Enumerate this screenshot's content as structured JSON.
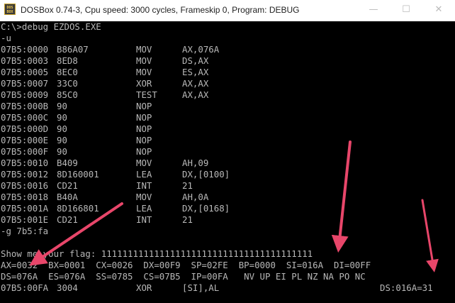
{
  "window": {
    "title": "DOSBox 0.74-3, Cpu speed:    3000 cycles, Frameskip  0, Program:   DEBUG",
    "icon_label": "DOS BOX",
    "buttons": {
      "minimize": "—",
      "maximize": "☐",
      "close": "✕"
    }
  },
  "terminal": {
    "prompt_line": "C:\\>debug EZDOS.EXE",
    "cmd_u": "-u",
    "disassembly": [
      {
        "addr": "07B5:0000",
        "bytes": "B86A07",
        "mnem": "MOV",
        "ops": "AX,076A"
      },
      {
        "addr": "07B5:0003",
        "bytes": "8ED8",
        "mnem": "MOV",
        "ops": "DS,AX"
      },
      {
        "addr": "07B5:0005",
        "bytes": "8EC0",
        "mnem": "MOV",
        "ops": "ES,AX"
      },
      {
        "addr": "07B5:0007",
        "bytes": "33C0",
        "mnem": "XOR",
        "ops": "AX,AX"
      },
      {
        "addr": "07B5:0009",
        "bytes": "85C0",
        "mnem": "TEST",
        "ops": "AX,AX"
      },
      {
        "addr": "07B5:000B",
        "bytes": "90",
        "mnem": "NOP",
        "ops": ""
      },
      {
        "addr": "07B5:000C",
        "bytes": "90",
        "mnem": "NOP",
        "ops": ""
      },
      {
        "addr": "07B5:000D",
        "bytes": "90",
        "mnem": "NOP",
        "ops": ""
      },
      {
        "addr": "07B5:000E",
        "bytes": "90",
        "mnem": "NOP",
        "ops": ""
      },
      {
        "addr": "07B5:000F",
        "bytes": "90",
        "mnem": "NOP",
        "ops": ""
      },
      {
        "addr": "07B5:0010",
        "bytes": "B409",
        "mnem": "MOV",
        "ops": "AH,09"
      },
      {
        "addr": "07B5:0012",
        "bytes": "8D160001",
        "mnem": "LEA",
        "ops": "DX,[0100]"
      },
      {
        "addr": "07B5:0016",
        "bytes": "CD21",
        "mnem": "INT",
        "ops": "21"
      },
      {
        "addr": "07B5:0018",
        "bytes": "B40A",
        "mnem": "MOV",
        "ops": "AH,0A"
      },
      {
        "addr": "07B5:001A",
        "bytes": "8D166801",
        "mnem": "LEA",
        "ops": "DX,[0168]"
      },
      {
        "addr": "07B5:001E",
        "bytes": "CD21",
        "mnem": "INT",
        "ops": "21"
      }
    ],
    "cmd_g": "-g 7b5:fa",
    "output_line": "Show me your flag: 1111111111111111111111111111111111111111",
    "registers_1": "AX=0032  BX=0001  CX=0026  DX=00F9  SP=02FE  BP=0000  SI=016A  DI=00FF",
    "registers_2": "DS=076A  ES=076A  SS=0785  CS=07B5  IP=00FA   NV UP EI PL NZ NA PO NC",
    "current_instr": {
      "addr": "07B5:00FA",
      "bytes": "3004",
      "mnem": "XOR",
      "ops": "[SI],AL",
      "mem": "DS:016A=31"
    }
  },
  "colors": {
    "terminal_bg": "#000000",
    "terminal_fg": "#b8b8b8",
    "annotation_arrow": "#e8466a"
  }
}
